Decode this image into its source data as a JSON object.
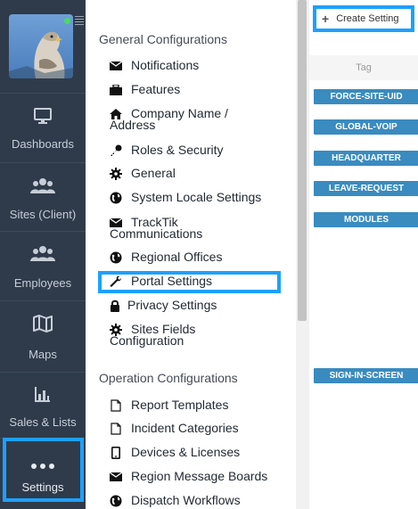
{
  "sidebar": {
    "items": [
      {
        "label": "Dashboards",
        "icon": "monitor-icon"
      },
      {
        "label": "Sites (Client)",
        "icon": "people-icon"
      },
      {
        "label": "Employees",
        "icon": "people-icon"
      },
      {
        "label": "Maps",
        "icon": "map-icon"
      },
      {
        "label": "Sales & Lists",
        "icon": "bar-chart-icon"
      },
      {
        "label": "Settings",
        "icon": "more-dots-icon"
      }
    ],
    "online_color": "#4cd964"
  },
  "config": {
    "general_title": "General Configurations",
    "general_items": [
      {
        "label": "Notifications",
        "icon": "envelope-icon"
      },
      {
        "label": "Features",
        "icon": "briefcase-icon"
      },
      {
        "label": "Company Name / Address",
        "icon": "home-icon"
      },
      {
        "label": "Roles & Security",
        "icon": "key-icon"
      },
      {
        "label": "General",
        "icon": "gear-icon"
      },
      {
        "label": "System Locale Settings",
        "icon": "globe-icon"
      },
      {
        "label": "TrackTik Communications",
        "icon": "envelope-icon"
      },
      {
        "label": "Regional Offices",
        "icon": "globe-icon"
      },
      {
        "label": "Portal Settings",
        "icon": "wrench-icon"
      },
      {
        "label": "Privacy Settings",
        "icon": "lock-icon"
      },
      {
        "label": "Sites Fields Configuration",
        "icon": "gear-icon"
      }
    ],
    "operation_title": "Operation Configurations",
    "operation_items": [
      {
        "label": "Report Templates",
        "icon": "file-icon"
      },
      {
        "label": "Incident Categories",
        "icon": "file-icon"
      },
      {
        "label": "Devices & Licenses",
        "icon": "mobile-icon"
      },
      {
        "label": "Region Message Boards",
        "icon": "envelope-icon"
      },
      {
        "label": "Dispatch Workflows",
        "icon": "globe-icon"
      }
    ]
  },
  "tags": {
    "create_label": "Create Setting",
    "header": "Tag",
    "items": [
      "FORCE-SITE-UID",
      "GLOBAL-VOIP",
      "HEADQUARTER",
      "LEAVE-REQUEST",
      "MODULES",
      "SIGN-IN-SCREEN"
    ],
    "accent": "#1ea0ff",
    "tag_color": "#3a8bbf"
  }
}
